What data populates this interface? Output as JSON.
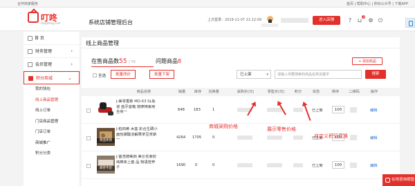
{
  "topbar": {
    "home_link": "合作商家服务",
    "right_links": "首页 | 帮助中心 | 你好公众号 | 下载APP"
  },
  "header": {
    "logo_text": "叮咚",
    "logo_sub": "dingdong.com",
    "system_name": "系统店铺管理后台",
    "last_login": "上次登录：2019-11-07 21:12:09",
    "to_shop": "进入店铺",
    "cart_badge": "0"
  },
  "sidebar": {
    "home": "首 页",
    "items": [
      {
        "label": "财务管理"
      },
      {
        "label": "会员管理"
      },
      {
        "label": "积分商城"
      }
    ],
    "sub_items": [
      "我的钱包",
      "线上商品管理",
      "线上订单",
      "门店商品管理",
      "门店订单",
      "商城推广",
      "积分分类"
    ]
  },
  "page": {
    "title": "线上商品管理"
  },
  "tabs": {
    "on_sale_label": "在售商品数",
    "on_sale_count": "55",
    "on_sale_max": "/ 70",
    "problem_label": "问题商品",
    "problem_count": "8"
  },
  "add_button": "+ 添加商品",
  "filter": {
    "select_all": "全选",
    "batch_price": "批量改价",
    "batch_off": "批量下架",
    "status_select": "已上架",
    "keyword_placeholder": "请输入你要搜索的商品名称关键字",
    "search": "搜索"
  },
  "columns": [
    "商品名称",
    "销量",
    "库存",
    "兑换量",
    "采购价(元)",
    "零售价(元)",
    "积分",
    "状态",
    "排序",
    "二维码",
    "操作"
  ],
  "rows": [
    {
      "name": "J-美零香斯 MD-X3 SL轨道 蓝牙音箱 按摩椅家用全身一",
      "sales": "648",
      "stock": "183",
      "exchange": "1",
      "status": "已上架",
      "sort": "100",
      "action": "编辑",
      "badge": ""
    },
    {
      "name": "J-柏四黄 木盒 彩合生硒小 面包碳酸溶解果茶豆茶斯一",
      "sales": "4264",
      "stock": "1705",
      "exchange": "0",
      "status": "已上架",
      "sort": "100",
      "action": "编辑",
      "badge": "商品失效"
    },
    {
      "name": "J-富浩德美四 美仑花家纺 纯棉床上套 品 物语苦荞子",
      "sales": "1690",
      "stock": "0",
      "exchange": "0",
      "status": "已上架",
      "sort": "100",
      "action": "编辑",
      "badge": "库存不足"
    }
  ],
  "annotations": {
    "purchase": "商城采购价格",
    "retail": "展示零售价格",
    "points": "自定义积分兑换"
  },
  "chat_button": "在线咨询按钮",
  "colors": {
    "brand": "#e2302b",
    "link": "#2a6fd6"
  }
}
